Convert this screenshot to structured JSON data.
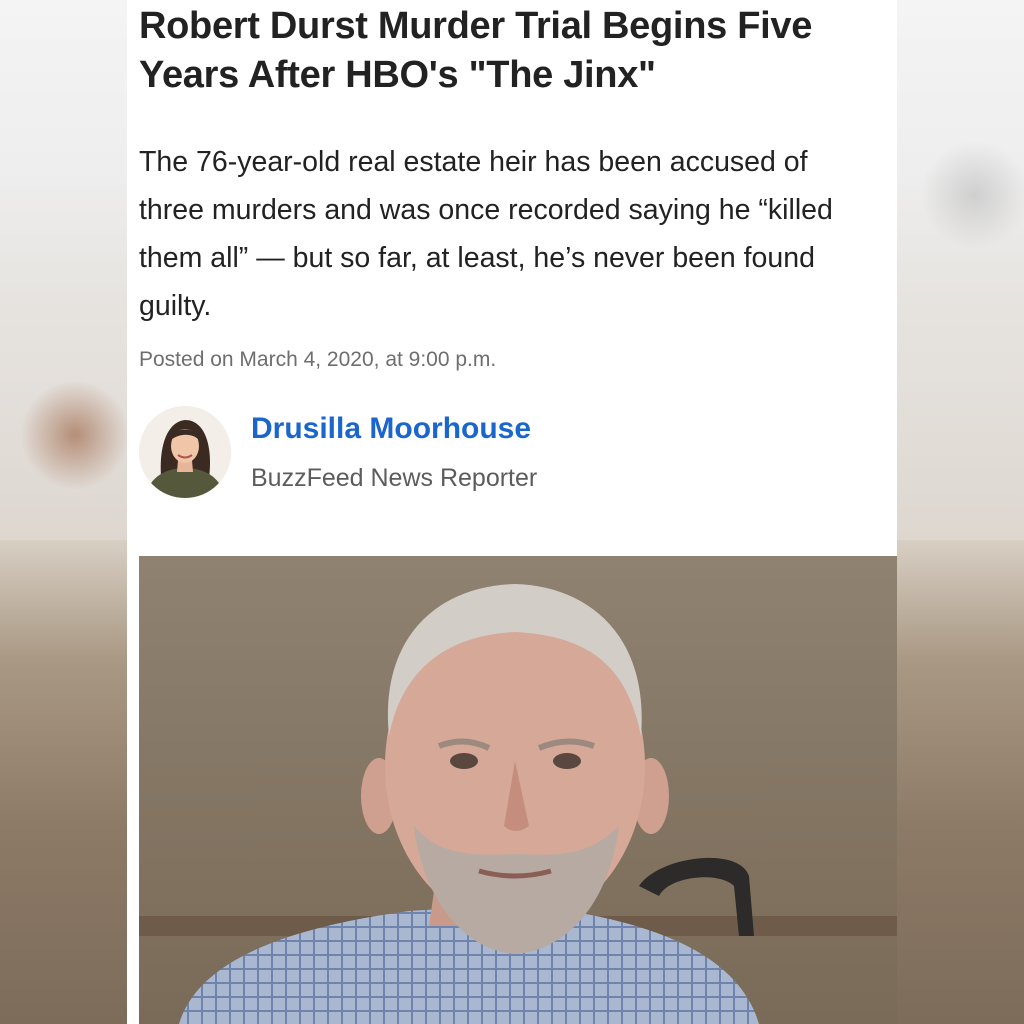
{
  "article": {
    "headline": "Robert Durst Murder Trial Begins Five Years After HBO's \"The Jinx\"",
    "dek": "The 76-year-old real estate heir has been accused of three murders and was once recorded saying he “killed them all” — but so far, at least, he’s never been found guilty.",
    "timestamp": "Posted on March 4, 2020, at 9:00 p.m."
  },
  "author": {
    "name": "Drusilla Moorhouse",
    "role": "BuzzFeed News Reporter"
  },
  "colors": {
    "author_link": "#1a66cc",
    "headline": "#222222",
    "meta": "#6e6e6e"
  }
}
